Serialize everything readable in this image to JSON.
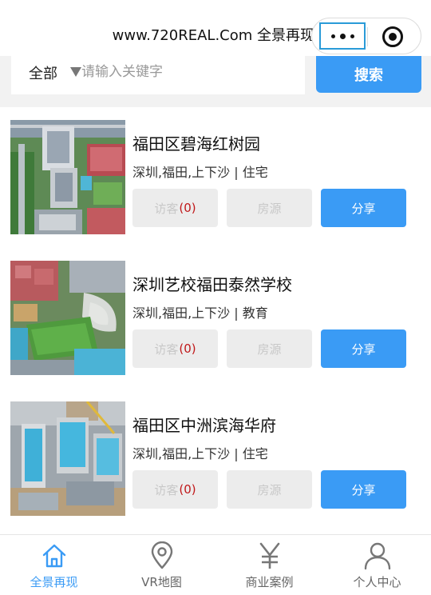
{
  "header": {
    "title": "www.720REAL.Com 全景再现"
  },
  "search": {
    "category": "全部",
    "placeholder": "请输入关键字",
    "button_label": "搜索"
  },
  "listings": [
    {
      "title": "福田区碧海红树园",
      "meta": "深圳,福田,上下沙 | 住宅",
      "visitor_label": "访客",
      "visitor_count": "(0)",
      "listing_label": "房源",
      "share_label": "分享"
    },
    {
      "title": "深圳艺校福田泰然学校",
      "meta": "深圳,福田,上下沙 | 教育",
      "visitor_label": "访客",
      "visitor_count": "(0)",
      "listing_label": "房源",
      "share_label": "分享"
    },
    {
      "title": "福田区中洲滨海华府",
      "meta": "深圳,福田,上下沙 | 住宅",
      "visitor_label": "访客",
      "visitor_count": "(0)",
      "listing_label": "房源",
      "share_label": "分享"
    }
  ],
  "tabbar": {
    "items": [
      {
        "label": "全景再现",
        "icon": "home-icon",
        "active": true
      },
      {
        "label": "VR地图",
        "icon": "map-pin-icon",
        "active": false
      },
      {
        "label": "商业案例",
        "icon": "yen-icon",
        "active": false
      },
      {
        "label": "个人中心",
        "icon": "user-icon",
        "active": false
      }
    ]
  },
  "colors": {
    "accent": "#3a9bf5",
    "count_red": "#c0181a",
    "disabled_bg": "#ececec"
  }
}
